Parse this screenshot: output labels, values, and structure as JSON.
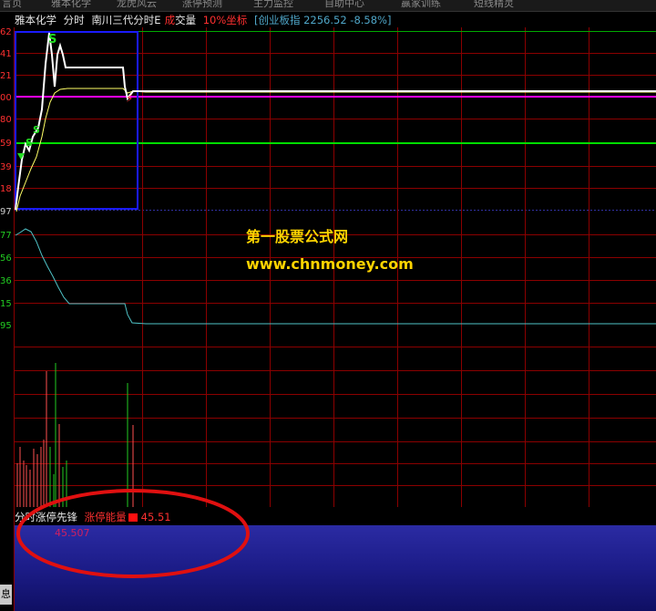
{
  "toolbar": {
    "items": [
      "言页",
      "雅本化学",
      "龙虎风云",
      "涨停预测",
      "主力监控",
      "自助中心",
      "赢家训练",
      "短线精灵"
    ]
  },
  "header": {
    "stock_name": "雅本化学",
    "mode": "分时",
    "formula": "南川三代分时E",
    "vol_a": "成",
    "vol_b": "交",
    "vol_c": "量",
    "coord_label": "10%坐标",
    "index_text": "[创业板指 2256.52 -8.58%]"
  },
  "y_labels_price": [
    "62",
    "41",
    "21",
    "00",
    "80",
    "59",
    "39",
    "18",
    "97"
  ],
  "y_labels_lower": [
    "77",
    "56",
    "36",
    "15",
    "95"
  ],
  "markers": {
    "s": "S",
    "lightning": "⚡"
  },
  "watermark": {
    "line1": "第一股票公式网",
    "line2": "www.chnmoney.com"
  },
  "indicator": {
    "name": "分时涨停先锋",
    "energy_label": "涨停能量",
    "energy_value": "45.51",
    "current_value": "45.507"
  },
  "side_tab": "息",
  "colors": {
    "grid": "#8b0000",
    "price": "#ffffff",
    "avg": "#ffff66",
    "green": "#00cc00",
    "magenta": "#ff00ff",
    "blue_box": "#1a1aff",
    "cyan": "#4fc3c7",
    "red": "#ff3030"
  }
}
